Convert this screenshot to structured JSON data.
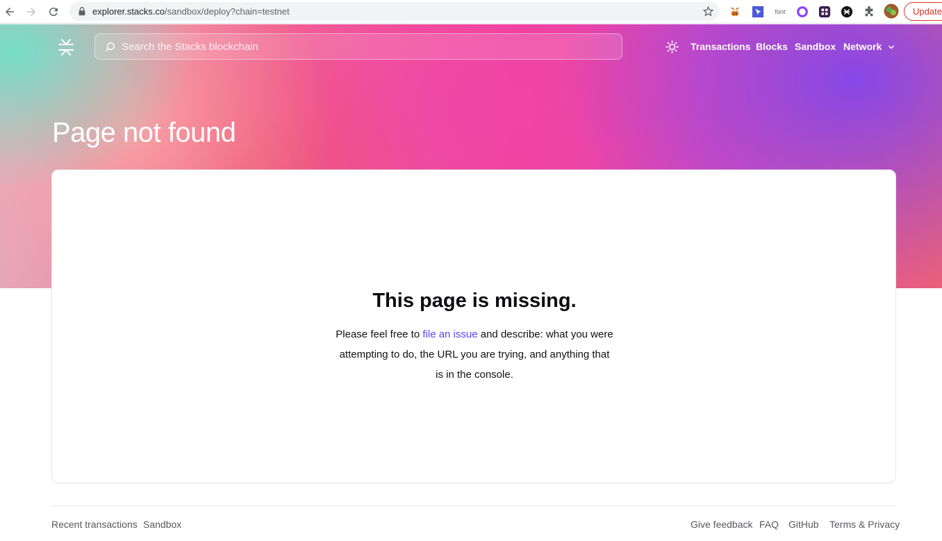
{
  "browser": {
    "url_host": "explorer.stacks.co",
    "url_path": "/sandbox/deploy?chain=testnet",
    "ext_font_label": "font",
    "update_label": "Update"
  },
  "header": {
    "search_placeholder": "Search the Stacks blockchain",
    "nav": {
      "transactions": "Transactions",
      "blocks": "Blocks",
      "sandbox": "Sandbox",
      "network": "Network"
    }
  },
  "hero": {
    "title": "Page not found"
  },
  "card": {
    "heading": "This page is missing.",
    "text_before": "Please feel free to ",
    "link": "file an issue",
    "text_after": " and describe: what you were attempting to do, the URL you are trying, and anything that is in the console."
  },
  "footer": {
    "left": [
      "Recent transactions",
      "Sandbox"
    ],
    "right": [
      "Give feedback",
      "FAQ",
      "GitHub",
      "Terms & Privacy"
    ]
  },
  "colors": {
    "accent": "#5546ff",
    "update_red": "#d93025"
  }
}
